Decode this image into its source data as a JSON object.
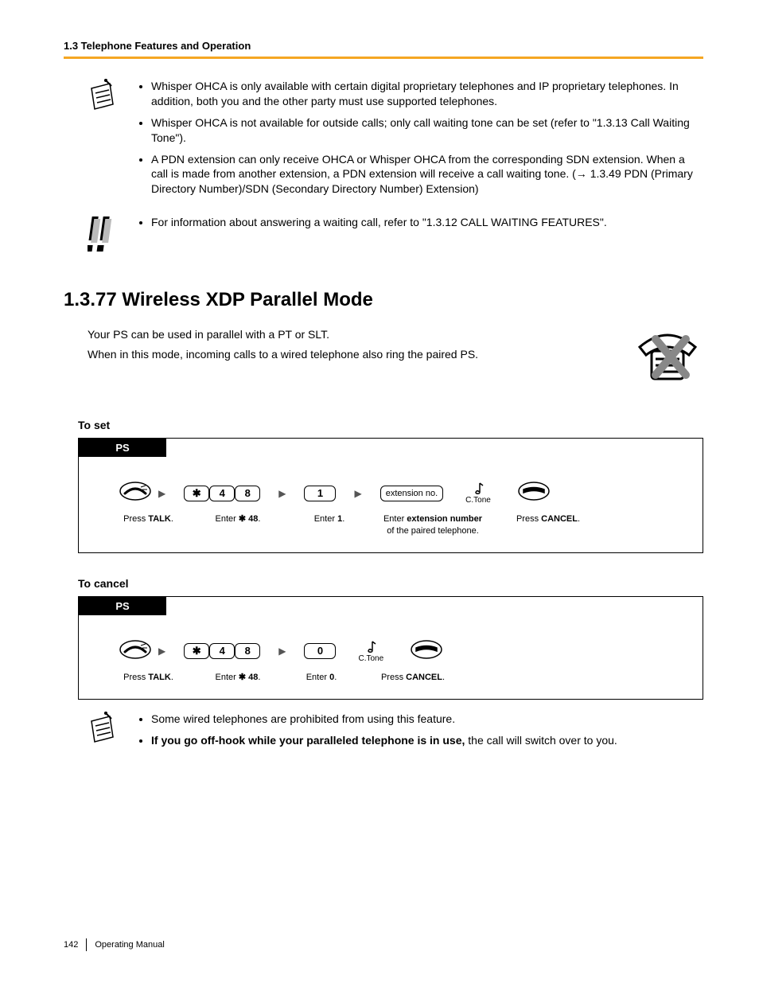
{
  "header": {
    "section": "1.3 Telephone Features and Operation"
  },
  "notes1": {
    "b1": "Whisper OHCA is only available with certain digital proprietary telephones and IP proprietary telephones. In addition, both you and the other party must use supported telephones.",
    "b2": "Whisper OHCA is not available for outside calls; only call waiting tone can be set (refer to \"1.3.13 Call Waiting Tone\").",
    "b3": "A PDN extension can only receive OHCA or Whisper OHCA from the corresponding SDN extension. When a call is made from another extension, a PDN extension will receive a call waiting tone. (→ 1.3.49 PDN (Primary Directory Number)/SDN (Secondary Directory Number) Extension)"
  },
  "notes2": {
    "b1": "For information about answering a waiting call, refer to \"1.3.12 CALL WAITING FEATURES\"."
  },
  "heading": "1.3.77  Wireless XDP Parallel Mode",
  "intro": {
    "l1": "Your PS can be used in parallel with a PT or SLT.",
    "l2": "When in this mode, incoming calls to a wired telephone also ring the paired PS."
  },
  "toset": {
    "title": "To set",
    "tab": "PS",
    "keys": {
      "star": "✱",
      "k4": "4",
      "k8": "8",
      "k1": "1"
    },
    "ext": "extension no.",
    "ctone": "C.Tone",
    "labels": {
      "talk_a": "Press ",
      "talk_b": "TALK",
      "talk_c": ".",
      "e48_a": "Enter ",
      "e48_b": "✱",
      "e48_c": " 48",
      "e48_d": ".",
      "e1_a": "Enter ",
      "e1_b": "1",
      "e1_c": ".",
      "ext_a": "Enter ",
      "ext_b": "extension number",
      "ext_c": "of the paired telephone.",
      "cancel_a": "Press ",
      "cancel_b": "CANCEL",
      "cancel_c": "."
    }
  },
  "tocancel": {
    "title": "To cancel",
    "tab": "PS",
    "keys": {
      "star": "✱",
      "k4": "4",
      "k8": "8",
      "k0": "0"
    },
    "ctone": "C.Tone",
    "labels": {
      "talk_a": "Press ",
      "talk_b": "TALK",
      "talk_c": ".",
      "e48_a": "Enter ",
      "e48_b": "✱",
      "e48_c": " 48",
      "e48_d": ".",
      "e0_a": "Enter ",
      "e0_b": "0",
      "e0_c": ".",
      "cancel_a": "Press ",
      "cancel_b": "CANCEL",
      "cancel_c": "."
    }
  },
  "notes3": {
    "b1": "Some wired telephones are prohibited from using this feature.",
    "b2a": "If you go off-hook while your paralleled telephone is in use,",
    "b2b": " the call will switch over to you."
  },
  "footer": {
    "page": "142",
    "doc": "Operating Manual"
  }
}
